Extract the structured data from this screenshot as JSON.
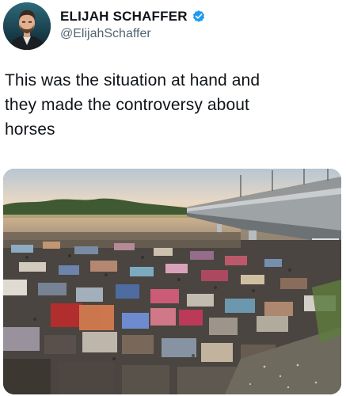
{
  "tweet": {
    "author": {
      "display_name": "ELIJAH SCHAFFER",
      "handle": "@ElijahSchaffer",
      "verified": true,
      "avatar_icon": "profile-photo"
    },
    "text_lines": [
      "This was the situation at hand and",
      "they made the controversy about",
      "horses"
    ],
    "media": {
      "kind": "photo",
      "icon": "photo-crowd-camp-under-bridge"
    }
  },
  "colors": {
    "name": "#0f1419",
    "handle": "#536471",
    "verified_badge": "#1d9bf0",
    "background": "#ffffff"
  }
}
